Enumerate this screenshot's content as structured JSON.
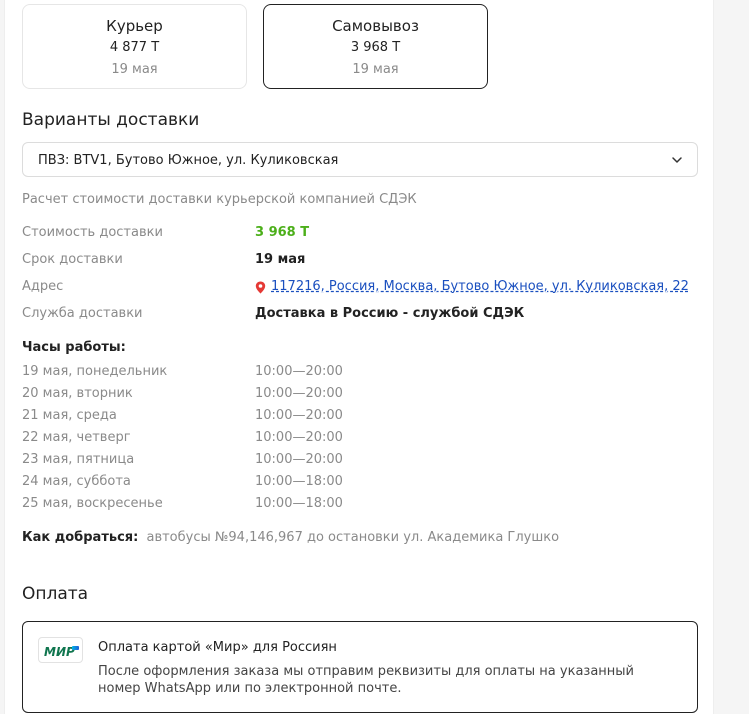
{
  "delivery_methods": [
    {
      "title": "Курьер",
      "price": "4 877 Т",
      "date": "19 мая",
      "selected": false
    },
    {
      "title": "Самовывоз",
      "price": "3 968 Т",
      "date": "19 мая",
      "selected": true
    }
  ],
  "delivery_options": {
    "heading": "Варианты доставки",
    "selected_value": "ПВЗ: BTV1, Бутово Южное, ул. Куликовская",
    "note": "Расчет стоимости доставки курьерской компанией СДЭК"
  },
  "details": {
    "cost_label": "Стоимость доставки",
    "cost_value": "3 968 Т",
    "term_label": "Срок доставки",
    "term_value": "19 мая",
    "address_label": "Адрес",
    "address_value": "117216, Россия, Москва, Бутово Южное, ул. Куликовская, 22",
    "service_label": "Служба доставки",
    "service_value": "Доставка в Россию - службой СДЭК"
  },
  "hours": {
    "title": "Часы работы:",
    "rows": [
      {
        "day": "19 мая, понедельник",
        "time": "10:00—20:00"
      },
      {
        "day": "20 мая, вторник",
        "time": "10:00—20:00"
      },
      {
        "day": "21 мая, среда",
        "time": "10:00—20:00"
      },
      {
        "day": "22 мая, четверг",
        "time": "10:00—20:00"
      },
      {
        "day": "23 мая, пятница",
        "time": "10:00—20:00"
      },
      {
        "day": "24 мая, суббота",
        "time": "10:00—18:00"
      },
      {
        "day": "25 мая, воскресенье",
        "time": "10:00—18:00"
      }
    ]
  },
  "how_to_get": {
    "label": "Как добраться:",
    "text": "автобусы №94,146,967 до остановки ул. Академика Глушко"
  },
  "payment": {
    "heading": "Оплата",
    "logo_text": "МИР",
    "title": "Оплата картой «Мир» для Россиян",
    "description": "После оформления заказа мы отправим реквизиты для оплаты на указанный номер WhatsApp или по электронной почте."
  },
  "colors": {
    "price_green": "#4caf1a",
    "link_blue": "#1a4fbf",
    "mir_green": "#0f754e",
    "mir_blue": "#00b4e6"
  }
}
